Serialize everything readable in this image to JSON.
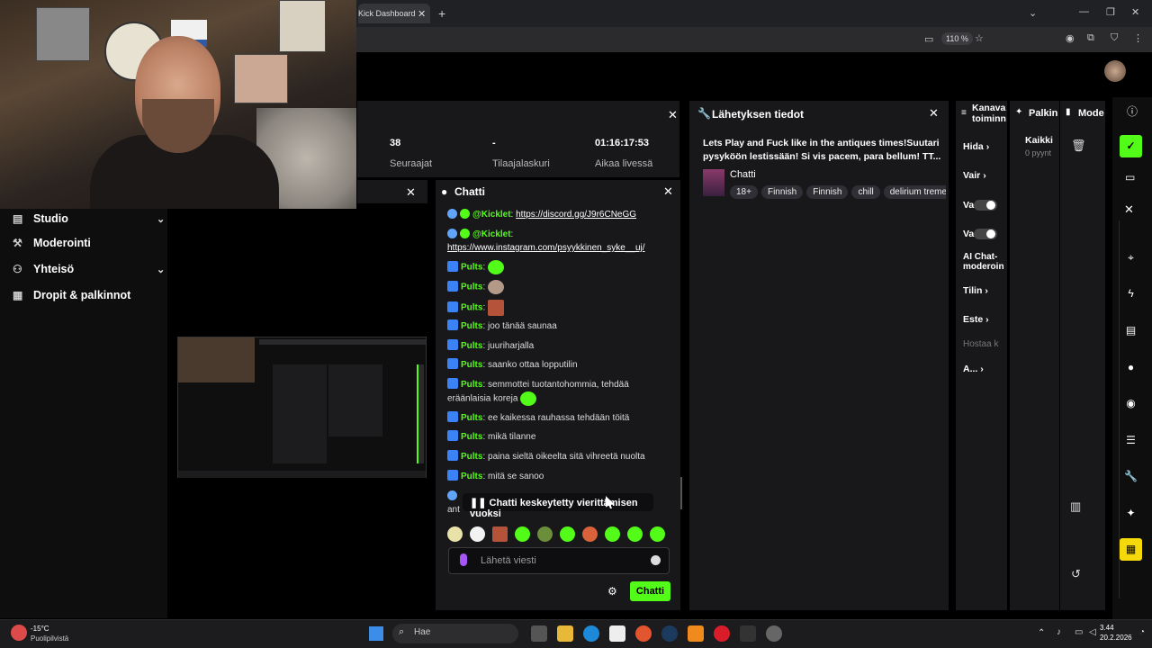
{
  "browser": {
    "tab_title": "Kick Dashboard",
    "zoom": "110 %"
  },
  "leftnav": {
    "items": [
      {
        "label": "Studio",
        "icon": "studio-icon",
        "has_chevron": true
      },
      {
        "label": "Moderointi",
        "icon": "moderation-icon",
        "has_chevron": false
      },
      {
        "label": "Yhteisö",
        "icon": "community-icon",
        "has_chevron": true
      },
      {
        "label": "Dropit & palkinnot",
        "icon": "drops-icon",
        "has_chevron": false
      }
    ]
  },
  "stats": {
    "followers_value": "38",
    "followers_label": "Seuraajat",
    "subs_value": "-",
    "subs_label": "Tilaajalaskuri",
    "live_value": "01:16:17:53",
    "live_label": "Aikaa livessä"
  },
  "chat": {
    "title": "Chatti",
    "messages": [
      {
        "user": "@Kicklet",
        "text": "https://discord.gg/J9r6CNeGG",
        "type": "bot-link"
      },
      {
        "user": "@Kicklet",
        "text": "https://www.instagram.com/psyykkinen_syke__uj/",
        "type": "bot-link"
      },
      {
        "user": "Pults",
        "text": "",
        "type": "emote"
      },
      {
        "user": "Pults",
        "text": "",
        "type": "emote"
      },
      {
        "user": "Pults",
        "text": "",
        "type": "emote"
      },
      {
        "user": "Pults",
        "text": "joo tänää saunaa",
        "type": "text"
      },
      {
        "user": "Pults",
        "text": "juuriharjalla",
        "type": "text"
      },
      {
        "user": "Pults",
        "text": "saanko ottaa lopputilin",
        "type": "text"
      },
      {
        "user": "Pults",
        "text": "semmottei tuotantohommia, tehdää eräänlaisia koreja",
        "type": "text"
      },
      {
        "user": "Pults",
        "text": "ee kaikessa rauhassa tehdään töitä",
        "type": "text"
      },
      {
        "user": "Pults",
        "text": "mikä tilanne",
        "type": "text"
      },
      {
        "user": "Pults",
        "text": "paina sieltä oikeelta sitä vihreetä nuolta",
        "type": "text"
      },
      {
        "user": "Pults",
        "text": "mitä se sanoo",
        "type": "text"
      }
    ],
    "partial_line": "ant",
    "paused_notice": "Chatti keskeytetty vierittämisen vuoksi",
    "input_placeholder": "Lähetä viesti",
    "send_label": "Chatti"
  },
  "broadcast": {
    "title": "Lähetyksen tiedot",
    "stream_title": "Lets Play and Fuck like in the antiques times!Suutari pysyköön lestissään! Si vis pacem, para bellum! TT...",
    "category": "Chatti",
    "tags": [
      "18+",
      "Finnish",
      "Finnish",
      "chill",
      "delirium tremens"
    ]
  },
  "kanava": {
    "title": "Kanava toiminn",
    "items": [
      "Hida",
      "Vair",
      "Va",
      "Va",
      "AI Chat-moderoin",
      "Tilin",
      "Este",
      "Hostaa k",
      "A..."
    ]
  },
  "palkin": {
    "title": "Palkin",
    "item": "Kaikki",
    "sub": "0 pyynt"
  },
  "mode": {
    "title": "Mode"
  },
  "taskbar": {
    "weather_temp": "-15°C",
    "weather_desc": "Puolipilvistä",
    "search_placeholder": "Hae",
    "time": "3.44",
    "date": "20.2.2026"
  },
  "colors": {
    "accent": "#53fc18",
    "panel": "#18181b",
    "background": "#000000"
  }
}
